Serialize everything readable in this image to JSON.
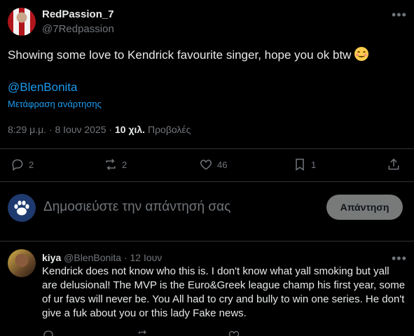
{
  "post": {
    "display_name": "RedPassion_7",
    "handle": "@7Redpassion",
    "text": "Showing some love to Kendrick favourite singer, hope you ok btw",
    "mention": "@BlenBonita",
    "translate_label": "Μετάφραση ανάρτησης",
    "time": "8:29 μ.μ. · 8 Ιουν 2025 · ",
    "views_count": "10 χιλ.",
    "views_label": " Προβολές"
  },
  "actions": {
    "replies": "2",
    "reposts": "2",
    "likes": "46",
    "bookmarks": "1"
  },
  "reply_box": {
    "placeholder": "Δημοσιεύστε την απάντησή σας",
    "button_label": "Απάντηση"
  },
  "reply": {
    "display_name": "kiya",
    "handle_time": "@BlenBonita · 12 Ιουν",
    "text": "Kendrick does not know who this is. I don't know what yall smoking but yall are delusional! The MVP is the Euro&Greek league champ his first year, some of ur favs will never be. You All had to cry and bully to win one series. He don't give a fuk about you or this lady Fake news."
  },
  "icons": [
    "more-icon",
    "reply-icon",
    "repost-icon",
    "like-icon",
    "bookmark-icon",
    "share-icon",
    "paw-icon",
    "emoji-icon"
  ]
}
